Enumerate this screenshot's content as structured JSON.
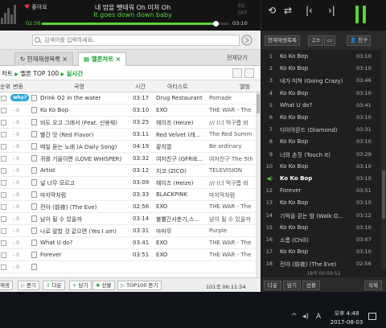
{
  "player": {
    "like_label": "좋아요",
    "lyric_current": "내 맘을 뺏테워 Oh 미쳐 Oh",
    "lyric_next": "It goes down down baby",
    "eq_label_top": "EQ",
    "eq_label_bottom": "OFF",
    "time_elapsed": "02:56",
    "time_total": "03:10",
    "progress_fraction": 0.93,
    "repeat_icon": "repeat-icon",
    "shuffle_icon": "shuffle-icon",
    "prev_icon": "previous-icon",
    "next_icon": "next-icon",
    "pause_icon": "pause-icon"
  },
  "search": {
    "placeholder": "검색어를 입력하세요."
  },
  "tabs": {
    "items": [
      {
        "label": "현재재생목록",
        "active": false
      },
      {
        "label": "멜론차트",
        "active": true
      }
    ],
    "all_label": "전체닫기"
  },
  "chart": {
    "breadcrumb_prefix": "차트",
    "breadcrumb_main": "멜론 TOP 100",
    "breadcrumb_sub": "실시간",
    "columns": {
      "change": "변동",
      "title": "곡명",
      "time": "시간",
      "artist": "아티스트",
      "album": "앨범"
    },
    "why_badge": "why?",
    "rows": [
      {
        "change": "",
        "title": "Drink O2 in the water",
        "time": "03:17",
        "artist": "Drug Restaurant",
        "album": "Pomade"
      },
      {
        "change": "- 0",
        "title": "Ko Ko Bop",
        "time": "03:10",
        "artist": "EXO",
        "album": "THE WAR - The"
      },
      {
        "change": "- 0",
        "title": "비도 오고 그래서 (Feat. 신용재)",
        "time": "03:25",
        "artist": "헤이즈 (Heize)",
        "album": "/// (너 먹구름 비"
      },
      {
        "change": "- 0",
        "title": "빨간 맛 (Red Flavor)",
        "time": "03:11",
        "artist": "Red Velvet (레...",
        "album": "The Red Summ"
      },
      {
        "change": "- 0",
        "title": "메일 듣는 노래 (A Daily Song)",
        "time": "04:19",
        "artist": "황치열",
        "album": "Be ordinary"
      },
      {
        "change": "- 0",
        "title": "귀를 기울이면 (LOVE WHISPER)",
        "time": "03:32",
        "artist": "여자친구 (GFRIE...",
        "album": "여자친구 The 5th"
      },
      {
        "change": "- 0",
        "title": "Artist",
        "time": "03:12",
        "artist": "지코 (ZICO)",
        "album": "TELEVISION"
      },
      {
        "change": "- 0",
        "title": "널 너무 모르고",
        "time": "03:09",
        "artist": "헤이즈 (Heize)",
        "album": "/// (너 먹구름 비"
      },
      {
        "change": "- 0",
        "title": "마지막처럼",
        "time": "03:33",
        "artist": "BLACKPINK",
        "album": "마지막처럼"
      },
      {
        "change": "- 0",
        "title": "전야 (前夜) (The Eve)",
        "time": "02:56",
        "artist": "EXO",
        "album": "THE WAR - The"
      },
      {
        "change": "- 0",
        "title": "남이 될 수 있을까",
        "time": "03:14",
        "artist": "볼빨간사춘기,스...",
        "album": "남이 될 수 있을까"
      },
      {
        "change": "- 0",
        "title": "나로 말할 것 같으면 (Yes I am)",
        "time": "03:31",
        "artist": "마마무",
        "album": "Purple"
      },
      {
        "change": "- 0",
        "title": "What U do?",
        "time": "03:41",
        "artist": "EXO",
        "album": "THE WAR - The"
      },
      {
        "change": "- 0",
        "title": "Forever",
        "time": "03:51",
        "artist": "EXO",
        "album": "THE WAR - The"
      },
      {
        "change": "- 0",
        "title": "",
        "time": "",
        "artist": "",
        "album": ""
      }
    ]
  },
  "bottom": {
    "play_selected": "재생",
    "listen": "듣기",
    "download": "다운",
    "add": "담기",
    "gift": "선물",
    "top100": "TOP100 듣기",
    "count": "101곡 06:11:54"
  },
  "playlist": {
    "tab_current": "현재재생목록",
    "tab_friend": "친구",
    "items": [
      {
        "n": "1",
        "title": "Ko Ko Bop",
        "dur": "03:10",
        "playing": false
      },
      {
        "n": "2",
        "title": "Ko Ko Bop",
        "dur": "03:10",
        "playing": false
      },
      {
        "n": "3",
        "title": "내가 미쳐 (Going Crazy)",
        "dur": "03:46",
        "playing": false
      },
      {
        "n": "4",
        "title": "Ko Ko Bop",
        "dur": "03:10",
        "playing": false
      },
      {
        "n": "5",
        "title": "What U do?",
        "dur": "03:41",
        "playing": false
      },
      {
        "n": "6",
        "title": "Ko Ko Bop",
        "dur": "03:10",
        "playing": false
      },
      {
        "n": "7",
        "title": "다이아몬드 (Diamond)",
        "dur": "03:31",
        "playing": false
      },
      {
        "n": "8",
        "title": "Ko Ko Bop",
        "dur": "03:10",
        "playing": false
      },
      {
        "n": "9",
        "title": "너의 손짓 (Touch It)",
        "dur": "03:29",
        "playing": false
      },
      {
        "n": "10",
        "title": "Ko Ko Bop",
        "dur": "03:10",
        "playing": false
      },
      {
        "n": "11",
        "title": "Ko Ko Bop",
        "dur": "03:10",
        "playing": true
      },
      {
        "n": "12",
        "title": "Forever",
        "dur": "03:51",
        "playing": false
      },
      {
        "n": "13",
        "title": "Ko Ko Bop",
        "dur": "03:10",
        "playing": false
      },
      {
        "n": "14",
        "title": "기억을 걷는 밤 (Walk O...",
        "dur": "03:12",
        "playing": false
      },
      {
        "n": "15",
        "title": "Ko Ko Bop",
        "dur": "03:10",
        "playing": false
      },
      {
        "n": "16",
        "title": "소름 (Chill)",
        "dur": "03:07",
        "playing": false
      },
      {
        "n": "17",
        "title": "Ko Ko Bop",
        "dur": "03:10",
        "playing": false
      },
      {
        "n": "18",
        "title": "전야 (前夜) (The Eve)",
        "dur": "02:56",
        "playing": false
      }
    ],
    "footer": "18곡 00:59:52",
    "btn_down": "다운",
    "btn_add": "담기",
    "btn_gift": "선물",
    "btn_delete": "삭제"
  },
  "taskbar": {
    "time": "오후 4:48",
    "date": "2017-08-03",
    "ime": "A"
  }
}
